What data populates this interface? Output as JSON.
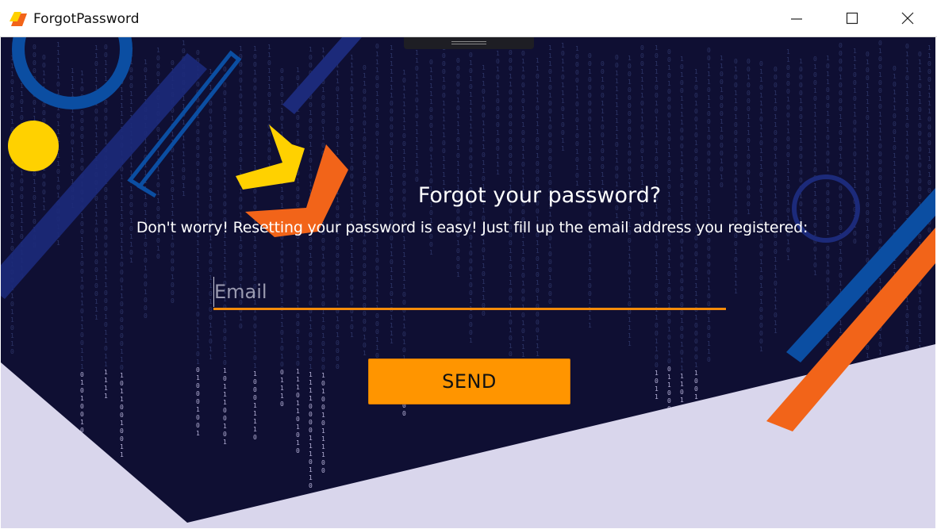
{
  "window": {
    "title": "ForgotPassword"
  },
  "form": {
    "heading": "Forgot your password?",
    "subtitle": "Don't worry! Resetting your password is easy! Just fill up the email address you registered:",
    "email_placeholder": "Email",
    "email_value": "",
    "send_label": "SEND"
  },
  "icons": {
    "app": "app-logo-icon",
    "minimize": "minimize-icon",
    "maximize": "maximize-icon",
    "close": "close-icon"
  },
  "colors": {
    "background": "#0f0f33",
    "accent_orange": "#ff9500",
    "shape_orange": "#f26419",
    "shape_yellow": "#ffd100",
    "shape_blue": "#0b4ea2",
    "light_panel": "#d9d6ec"
  }
}
